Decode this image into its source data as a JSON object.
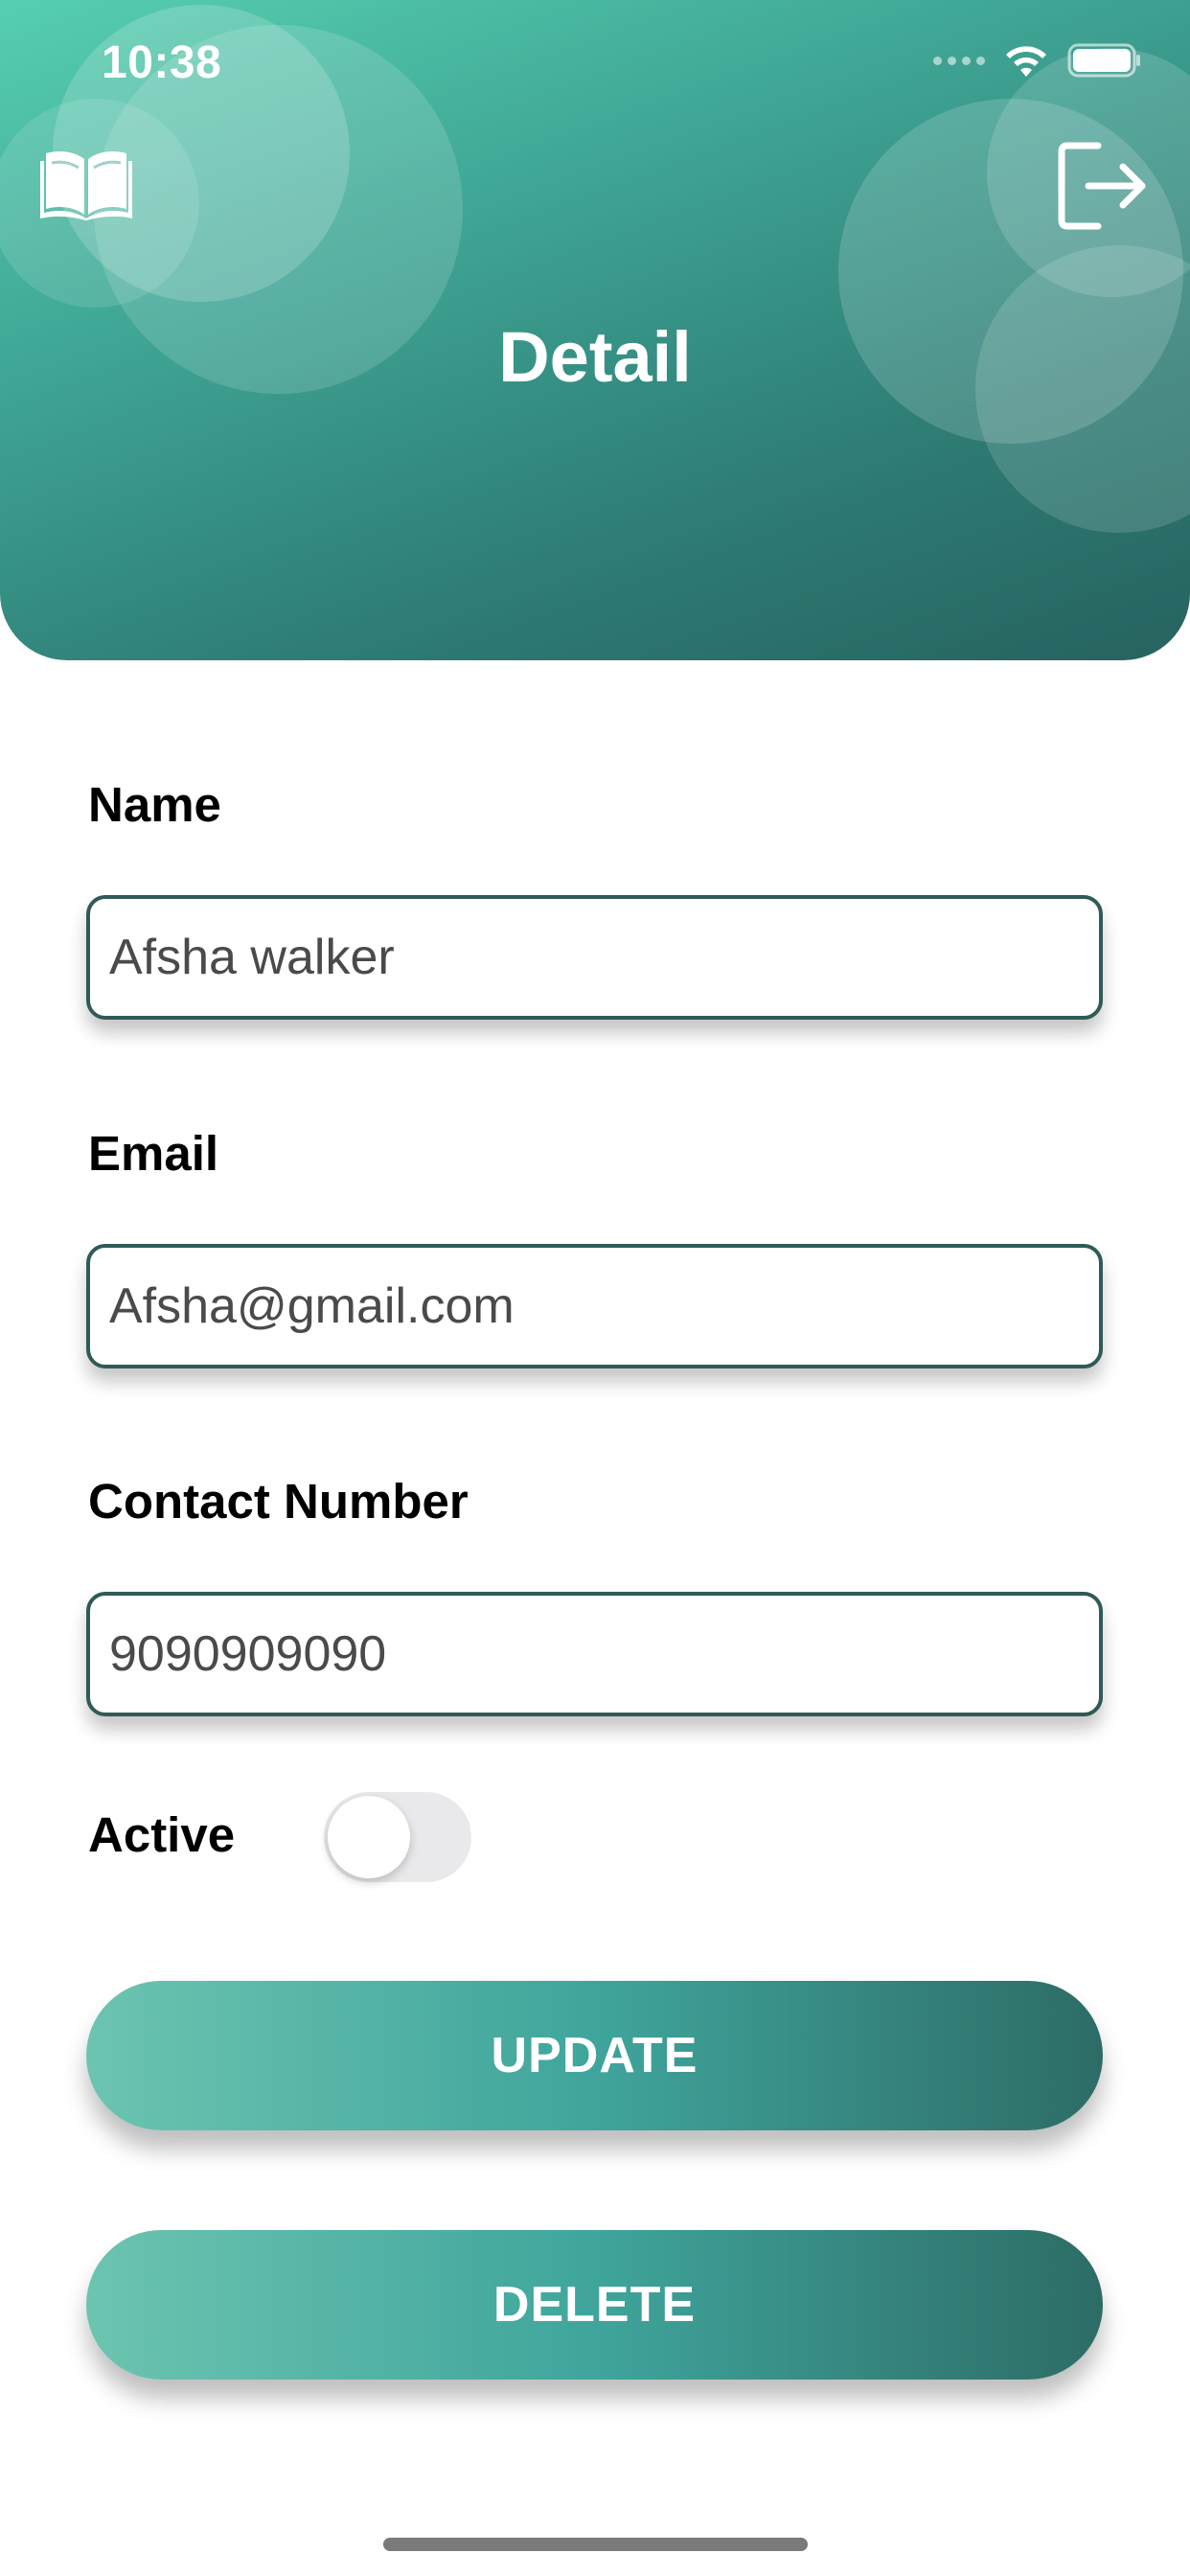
{
  "status_bar": {
    "time": "10:38"
  },
  "header": {
    "title": "Detail",
    "left_icon": "book-icon",
    "right_icon": "logout-icon",
    "gradient_start": "#56cfb0",
    "gradient_end": "#27625f"
  },
  "form": {
    "name": {
      "label": "Name",
      "value": "Afsha walker"
    },
    "email": {
      "label": "Email",
      "value": "Afsha@gmail.com"
    },
    "contact": {
      "label": "Contact Number",
      "value": "9090909090"
    },
    "active": {
      "label": "Active",
      "on": false
    }
  },
  "actions": {
    "update_label": "UPDATE",
    "delete_label": "DELETE"
  },
  "colors": {
    "field_border": "#2f5a57",
    "button_gradient_start": "#6cc4b0",
    "button_gradient_end": "#2d6c66",
    "toggle_off": "#e9e9eb"
  }
}
